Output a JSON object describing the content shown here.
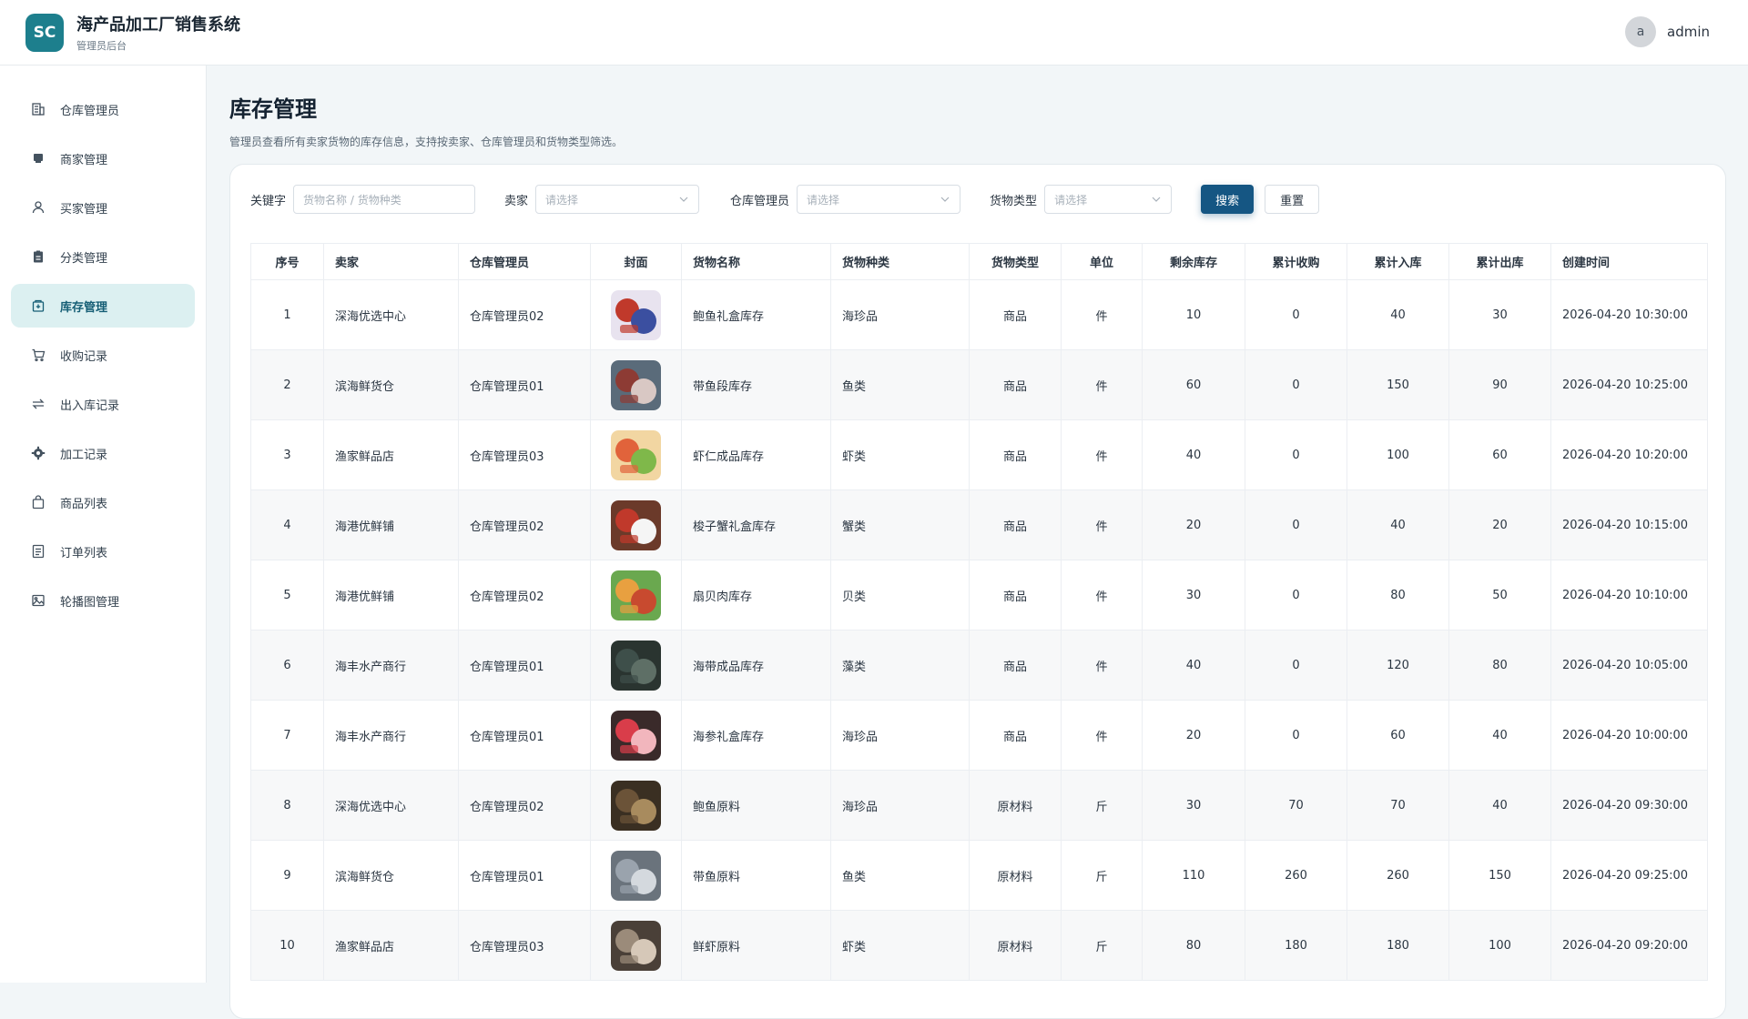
{
  "app": {
    "logo": "SC",
    "title": "海产品加工厂销售系统",
    "subtitle": "管理员后台"
  },
  "user": {
    "avatar": "a",
    "name": "admin"
  },
  "sidebar": {
    "items": [
      {
        "label": "仓库管理员",
        "icon": "building-icon"
      },
      {
        "label": "商家管理",
        "icon": "shop-icon"
      },
      {
        "label": "买家管理",
        "icon": "user-icon"
      },
      {
        "label": "分类管理",
        "icon": "clipboard-icon"
      },
      {
        "label": "库存管理",
        "icon": "box-icon",
        "active": true
      },
      {
        "label": "收购记录",
        "icon": "cart-icon"
      },
      {
        "label": "出入库记录",
        "icon": "transfer-icon"
      },
      {
        "label": "加工记录",
        "icon": "gear-icon"
      },
      {
        "label": "商品列表",
        "icon": "bag-icon"
      },
      {
        "label": "订单列表",
        "icon": "list-icon"
      },
      {
        "label": "轮播图管理",
        "icon": "image-icon"
      }
    ]
  },
  "page": {
    "title": "库存管理",
    "description": "管理员查看所有卖家货物的库存信息，支持按卖家、仓库管理员和货物类型筛选。"
  },
  "filters": {
    "keyword_label": "关键字",
    "keyword_placeholder": "货物名称 / 货物种类",
    "seller_label": "卖家",
    "seller_placeholder": "请选择",
    "manager_label": "仓库管理员",
    "manager_placeholder": "请选择",
    "type_label": "货物类型",
    "type_placeholder": "请选择",
    "search_label": "搜索",
    "reset_label": "重置"
  },
  "table": {
    "headers": [
      "序号",
      "卖家",
      "仓库管理员",
      "封面",
      "货物名称",
      "货物种类",
      "货物类型",
      "单位",
      "剩余库存",
      "累计收购",
      "累计入库",
      "累计出库",
      "创建时间"
    ],
    "rows": [
      [
        "1",
        "深海优选中心",
        "仓库管理员02",
        "gift-box-abalone",
        "鲍鱼礼盒库存",
        "海珍品",
        "商品",
        "件",
        "10",
        "0",
        "40",
        "30",
        "2026-04-20 10:30:00"
      ],
      [
        "2",
        "滨海鲜货仓",
        "仓库管理员01",
        "hairtail-segment",
        "带鱼段库存",
        "鱼类",
        "商品",
        "件",
        "60",
        "0",
        "150",
        "90",
        "2026-04-20 10:25:00"
      ],
      [
        "3",
        "渔家鲜品店",
        "仓库管理员03",
        "shrimp-dish",
        "虾仁成品库存",
        "虾类",
        "商品",
        "件",
        "40",
        "0",
        "100",
        "60",
        "2026-04-20 10:20:00"
      ],
      [
        "4",
        "海港优鲜铺",
        "仓库管理员02",
        "crab-gift",
        "梭子蟹礼盒库存",
        "蟹类",
        "商品",
        "件",
        "20",
        "0",
        "40",
        "20",
        "2026-04-20 10:15:00"
      ],
      [
        "5",
        "海港优鲜铺",
        "仓库管理员02",
        "scallop-dish",
        "扇贝肉库存",
        "贝类",
        "商品",
        "件",
        "30",
        "0",
        "80",
        "50",
        "2026-04-20 10:10:00"
      ],
      [
        "6",
        "海丰水产商行",
        "仓库管理员01",
        "kelp-rolls",
        "海带成品库存",
        "藻类",
        "商品",
        "件",
        "40",
        "0",
        "120",
        "80",
        "2026-04-20 10:05:00"
      ],
      [
        "7",
        "海丰水产商行",
        "仓库管理员01",
        "sea-cucumber-gift",
        "海参礼盒库存",
        "海珍品",
        "商品",
        "件",
        "20",
        "0",
        "60",
        "40",
        "2026-04-20 10:00:00"
      ],
      [
        "8",
        "深海优选中心",
        "仓库管理员02",
        "raw-abalone",
        "鲍鱼原料",
        "海珍品",
        "原材料",
        "斤",
        "30",
        "70",
        "70",
        "40",
        "2026-04-20 09:30:00"
      ],
      [
        "9",
        "滨海鲜货仓",
        "仓库管理员01",
        "raw-hairtail",
        "带鱼原料",
        "鱼类",
        "原材料",
        "斤",
        "110",
        "260",
        "260",
        "150",
        "2026-04-20 09:25:00"
      ],
      [
        "10",
        "渔家鲜品店",
        "仓库管理员03",
        "raw-shrimp",
        "鲜虾原料",
        "虾类",
        "原材料",
        "斤",
        "80",
        "180",
        "180",
        "100",
        "2026-04-20 09:20:00"
      ]
    ]
  },
  "colors": {
    "accent": "#155683",
    "logo": "#1d7f8d",
    "active_bg": "#dcf0f1"
  }
}
